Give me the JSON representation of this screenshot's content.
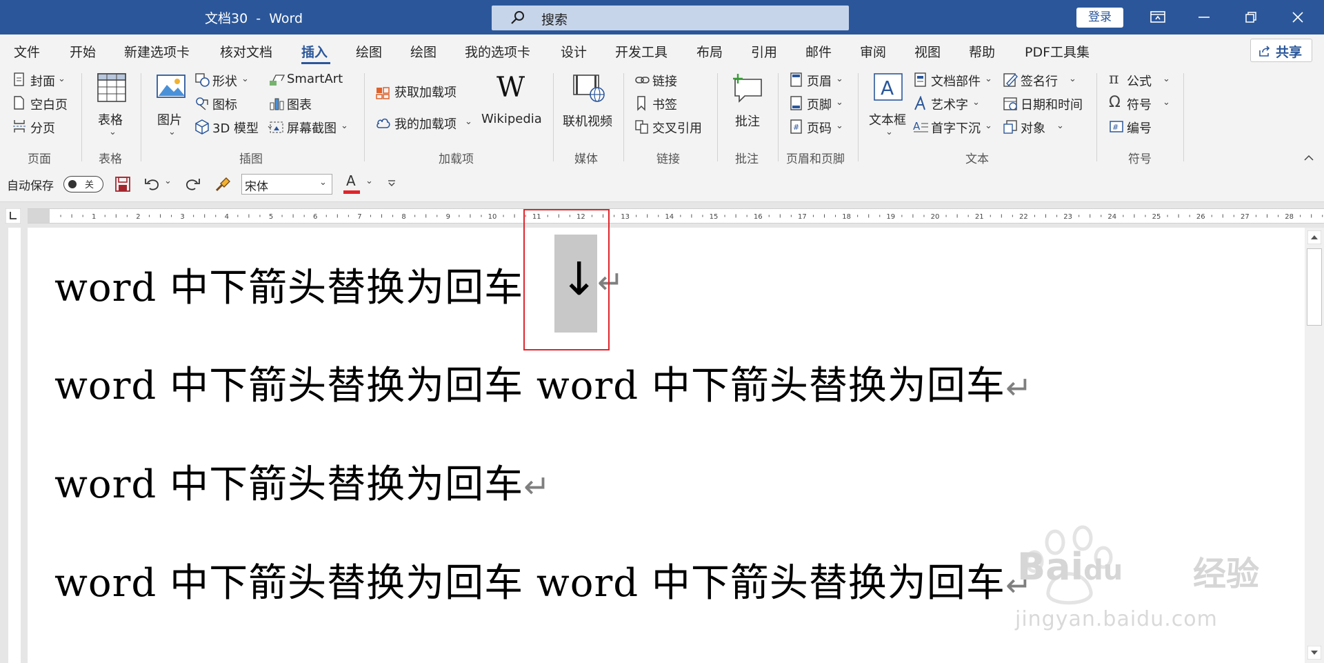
{
  "titlebar": {
    "doc_title": "文档30  -  Word",
    "search_placeholder": "搜索",
    "login": "登录"
  },
  "menu": {
    "tabs": [
      "文件",
      "开始",
      "新建选项卡",
      "核对文档",
      "插入",
      "绘图",
      "绘图",
      "我的选项卡",
      "设计",
      "开发工具",
      "布局",
      "引用",
      "邮件",
      "审阅",
      "视图",
      "帮助",
      "PDF工具集"
    ],
    "active": "插入",
    "share": "共享"
  },
  "ribbon": {
    "page": {
      "cover": "封面",
      "blank": "空白页",
      "break": "分页",
      "label": "页面"
    },
    "table": {
      "table": "表格",
      "label": "表格"
    },
    "illust": {
      "picture": "图片",
      "shape": "形状",
      "icon": "图标",
      "model3d": "3D 模型",
      "smartart": "SmartArt",
      "chart": "图表",
      "screenshot": "屏幕截图",
      "label": "插图"
    },
    "addins": {
      "get": "获取加载项",
      "mine": "我的加载项",
      "wiki": "Wikipedia",
      "label": "加载项"
    },
    "media": {
      "video": "联机视频",
      "label": "媒体"
    },
    "links": {
      "link": "链接",
      "bookmark": "书签",
      "xref": "交叉引用",
      "label": "链接"
    },
    "comments": {
      "comment": "批注",
      "label": "批注"
    },
    "hf": {
      "header": "页眉",
      "footer": "页脚",
      "pagenum": "页码",
      "label": "页眉和页脚"
    },
    "text": {
      "textbox": "文本框",
      "parts": "文档部件",
      "wordart": "艺术字",
      "dropcap": "首字下沉",
      "sigline": "签名行",
      "datetime": "日期和时间",
      "object": "对象",
      "label": "文本"
    },
    "symbols": {
      "equation": "公式",
      "symbol": "符号",
      "number": "编号",
      "label": "符号"
    }
  },
  "qat": {
    "autosave": "自动保存",
    "toggle_state": "关",
    "font": "宋体",
    "font_color": "#e0242a"
  },
  "document": {
    "lines": [
      "word 中下箭头替换为回车",
      "word 中下箭头替换为回车 word 中下箭头替换为回车",
      "word 中下箭头替换为回车",
      "word 中下箭头替换为回车 word 中下箭头替换为回车"
    ],
    "highlighted_char": "↓",
    "para_mark": "↵"
  },
  "ruler": {
    "numbers": [
      "1",
      "2",
      "3",
      "4",
      "5",
      "6",
      "7",
      "8",
      "9",
      "10",
      "11",
      "12",
      "13",
      "14",
      "15",
      "16",
      "17",
      "18",
      "19",
      "20",
      "21",
      "22",
      "23",
      "24",
      "25",
      "26",
      "27",
      "28"
    ]
  },
  "watermark": {
    "brand": "Bai",
    "brand2": "du",
    "cn": "经验",
    "url": "jingyan.baidu.com"
  },
  "colors": {
    "title_blue": "#2b579a",
    "red_box": "#e0242a",
    "highlight": "#c8c8c8"
  }
}
